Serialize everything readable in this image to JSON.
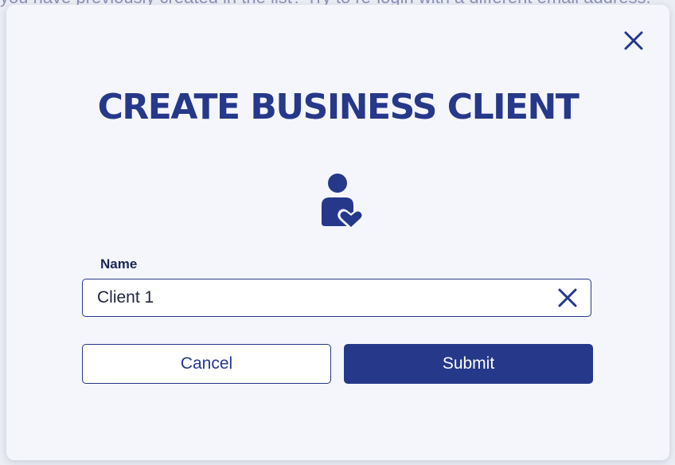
{
  "background": {
    "text": "you have previously created in the list?  Try to re-login with a different email address."
  },
  "modal": {
    "title": "CREATE BUSINESS CLIENT",
    "close_icon": "close-icon",
    "header_icon": "user-heart-icon",
    "name_field": {
      "label": "Name",
      "value": "Client 1",
      "clear_icon": "clear-icon"
    },
    "buttons": {
      "cancel_label": "Cancel",
      "submit_label": "Submit"
    }
  },
  "colors": {
    "primary": "#26388a",
    "modal_background": "#f5f6fc",
    "page_background": "#eceef5",
    "input_background": "#ffffff"
  }
}
